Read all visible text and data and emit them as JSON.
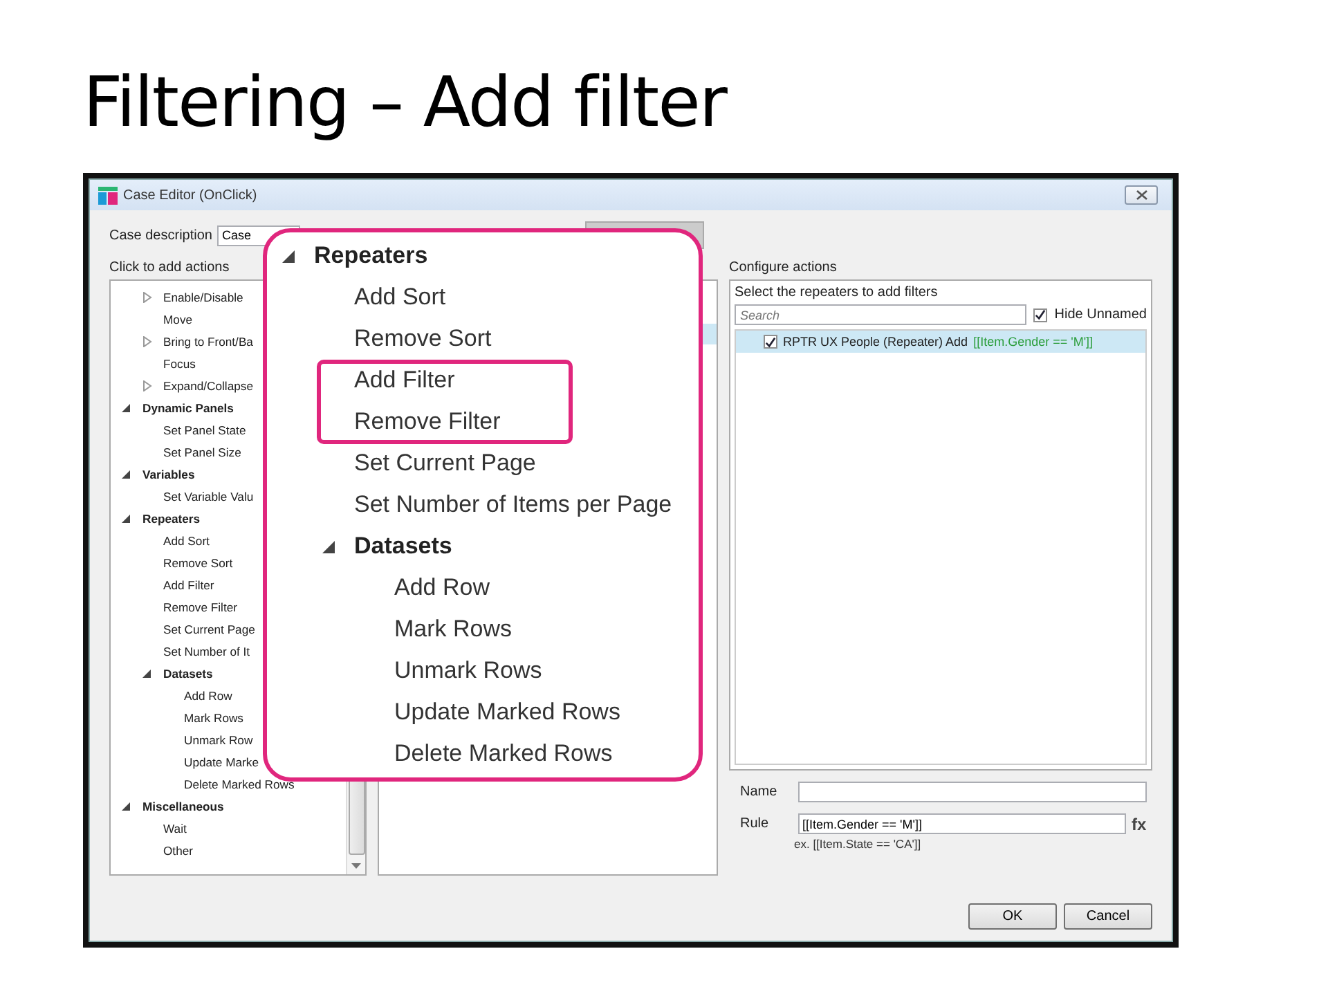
{
  "slide": {
    "title": "Filtering – Add filter"
  },
  "window": {
    "title": "Case Editor (OnClick)"
  },
  "case_description": {
    "label": "Case description",
    "value": "Case"
  },
  "actions_panel": {
    "label": "Click to add actions",
    "partial_items": [
      {
        "label": "Enable/Disable",
        "kind": "action",
        "expanded": false
      },
      {
        "label": "Move",
        "kind": "action"
      },
      {
        "label": "Bring to Front/Ba",
        "kind": "action",
        "expanded": false
      },
      {
        "label": "Focus",
        "kind": "action"
      },
      {
        "label": "Expand/Collapse",
        "kind": "action",
        "expanded": false
      }
    ],
    "tree": [
      {
        "label": "Dynamic Panels",
        "kind": "category",
        "expanded": true,
        "children": [
          {
            "label": "Set Panel State",
            "kind": "action"
          },
          {
            "label": "Set Panel Size",
            "kind": "action"
          }
        ]
      },
      {
        "label": "Variables",
        "kind": "category",
        "expanded": true,
        "children": [
          {
            "label": "Set Variable Valu",
            "kind": "action"
          }
        ]
      },
      {
        "label": "Repeaters",
        "kind": "category",
        "expanded": true,
        "children": [
          {
            "label": "Add Sort",
            "kind": "action"
          },
          {
            "label": "Remove Sort",
            "kind": "action"
          },
          {
            "label": "Add Filter",
            "kind": "action"
          },
          {
            "label": "Remove Filter",
            "kind": "action"
          },
          {
            "label": "Set Current Page",
            "kind": "action"
          },
          {
            "label": "Set Number of It",
            "kind": "action"
          },
          {
            "label": "Datasets",
            "kind": "category",
            "expanded": true,
            "children": [
              {
                "label": "Add Row",
                "kind": "action"
              },
              {
                "label": "Mark Rows",
                "kind": "action"
              },
              {
                "label": "Unmark Row",
                "kind": "action"
              },
              {
                "label": "Update Marke",
                "kind": "action"
              },
              {
                "label": "Delete Marked Rows",
                "kind": "action"
              }
            ]
          }
        ]
      },
      {
        "label": "Miscellaneous",
        "kind": "category",
        "expanded": true,
        "children": [
          {
            "label": "Wait",
            "kind": "action"
          },
          {
            "label": "Other",
            "kind": "action"
          }
        ]
      }
    ]
  },
  "organize_panel": {
    "rows": [
      {
        "selected": true
      }
    ]
  },
  "callout": {
    "tree": [
      {
        "label": "Repeaters",
        "kind": "category",
        "expanded": true,
        "highlighted": false,
        "children": [
          {
            "label": "Add Sort",
            "kind": "action",
            "highlighted": false
          },
          {
            "label": "Remove Sort",
            "kind": "action",
            "highlighted": false
          },
          {
            "label": "Add Filter",
            "kind": "action",
            "highlighted": true
          },
          {
            "label": "Remove Filter",
            "kind": "action",
            "highlighted": true
          },
          {
            "label": "Set Current Page",
            "kind": "action",
            "highlighted": false
          },
          {
            "label": "Set Number of Items per Page",
            "kind": "action",
            "highlighted": false
          },
          {
            "label": "Datasets",
            "kind": "category",
            "expanded": true,
            "highlighted": false,
            "children": [
              {
                "label": "Add Row",
                "kind": "action",
                "highlighted": false
              },
              {
                "label": "Mark Rows",
                "kind": "action",
                "highlighted": false
              },
              {
                "label": "Unmark Rows",
                "kind": "action",
                "highlighted": false
              },
              {
                "label": "Update Marked Rows",
                "kind": "action",
                "highlighted": false
              },
              {
                "label": "Delete Marked Rows",
                "kind": "action",
                "highlighted": false
              }
            ]
          }
        ]
      }
    ]
  },
  "configure": {
    "label": "Configure actions",
    "prompt": "Select the repeaters to add filters",
    "search": {
      "placeholder": "Search"
    },
    "hide_unnamed": {
      "label": "Hide Unnamed",
      "checked": true
    },
    "repeaters": [
      {
        "label": "RPTR UX People (Repeater) Add",
        "rule": "[[Item.Gender == 'M']]",
        "checked": true,
        "selected": true
      }
    ],
    "name": {
      "label": "Name"
    },
    "rule": {
      "label": "Rule",
      "value": "[[Item.Gender == 'M']]",
      "fx": "fx",
      "hint": "ex. [[Item.State == 'CA']]"
    }
  },
  "buttons": [
    "OK",
    "Cancel"
  ]
}
